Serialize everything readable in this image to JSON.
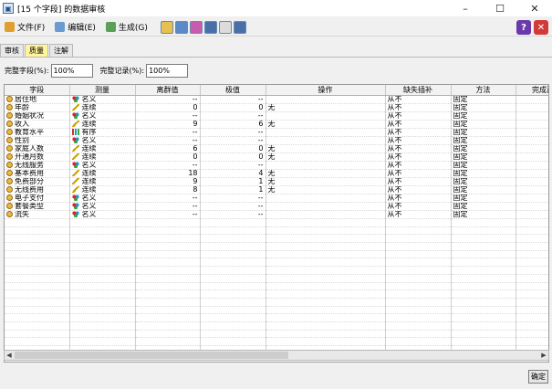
{
  "window": {
    "title": "[15 个字段] 的数据审核",
    "minimize": "–",
    "maximize": "☐",
    "close": "✕"
  },
  "menu": [
    {
      "label": "文件(F)",
      "color": "#e0a030"
    },
    {
      "label": "编辑(E)",
      "color": "#6a9ad0"
    },
    {
      "label": "生成(G)",
      "color": "#5aa05a"
    }
  ],
  "toolbar": {
    "colors": [
      "#e8c050",
      "#5a8ac8",
      "#c85ab0",
      "#4a6ea8",
      "#dcdcdc",
      "#4a6ea8"
    ]
  },
  "help": {
    "help_label": "?",
    "close_label": "✕",
    "help_color": "#6a3aa8",
    "close_color": "#d23a3a"
  },
  "tabs": [
    "审核",
    "质量",
    "注解"
  ],
  "fields": {
    "complete_fields_label": "完整字段(%):",
    "complete_fields_value": "100%",
    "complete_records_label": "完整记录(%):",
    "complete_records_value": "100%"
  },
  "columns": [
    "字段",
    "测量",
    "离群值",
    "极值",
    "操作",
    "缺失插补",
    "方法",
    "完成百"
  ],
  "rows": [
    {
      "field": "居住地",
      "measure": "名义",
      "mtype": "nominal",
      "outliers": "--",
      "extremes": "--",
      "action": "",
      "impute": "从不",
      "method": "固定"
    },
    {
      "field": "年龄",
      "measure": "连续",
      "mtype": "continuous",
      "outliers": "0",
      "extremes": "0",
      "action": "无",
      "impute": "从不",
      "method": "固定"
    },
    {
      "field": "婚姻状况",
      "measure": "名义",
      "mtype": "nominal",
      "outliers": "--",
      "extremes": "--",
      "action": "",
      "impute": "从不",
      "method": "固定"
    },
    {
      "field": "收入",
      "measure": "连续",
      "mtype": "continuous",
      "outliers": "9",
      "extremes": "6",
      "action": "无",
      "impute": "从不",
      "method": "固定"
    },
    {
      "field": "教育水平",
      "measure": "有序",
      "mtype": "ordinal",
      "outliers": "--",
      "extremes": "--",
      "action": "",
      "impute": "从不",
      "method": "固定"
    },
    {
      "field": "性别",
      "measure": "名义",
      "mtype": "nominal",
      "outliers": "--",
      "extremes": "--",
      "action": "",
      "impute": "从不",
      "method": "固定"
    },
    {
      "field": "家庭人数",
      "measure": "连续",
      "mtype": "continuous",
      "outliers": "6",
      "extremes": "0",
      "action": "无",
      "impute": "从不",
      "method": "固定"
    },
    {
      "field": "开通月数",
      "measure": "连续",
      "mtype": "continuous",
      "outliers": "0",
      "extremes": "0",
      "action": "无",
      "impute": "从不",
      "method": "固定"
    },
    {
      "field": "无线服务",
      "measure": "名义",
      "mtype": "nominal",
      "outliers": "--",
      "extremes": "--",
      "action": "",
      "impute": "从不",
      "method": "固定"
    },
    {
      "field": "基本费用",
      "measure": "连续",
      "mtype": "continuous",
      "outliers": "18",
      "extremes": "4",
      "action": "无",
      "impute": "从不",
      "method": "固定"
    },
    {
      "field": "免费部分",
      "measure": "连续",
      "mtype": "continuous",
      "outliers": "9",
      "extremes": "1",
      "action": "无",
      "impute": "从不",
      "method": "固定"
    },
    {
      "field": "无线费用",
      "measure": "连续",
      "mtype": "continuous",
      "outliers": "8",
      "extremes": "1",
      "action": "无",
      "impute": "从不",
      "method": "固定"
    },
    {
      "field": "电子支付",
      "measure": "名义",
      "mtype": "nominal",
      "outliers": "--",
      "extremes": "--",
      "action": "",
      "impute": "从不",
      "method": "固定"
    },
    {
      "field": "套餐类型",
      "measure": "名义",
      "mtype": "nominal",
      "outliers": "--",
      "extremes": "--",
      "action": "",
      "impute": "从不",
      "method": "固定"
    },
    {
      "field": "流失",
      "measure": "名义",
      "mtype": "nominal",
      "outliers": "--",
      "extremes": "--",
      "action": "",
      "impute": "从不",
      "method": "固定"
    }
  ],
  "ok_label": "确定"
}
